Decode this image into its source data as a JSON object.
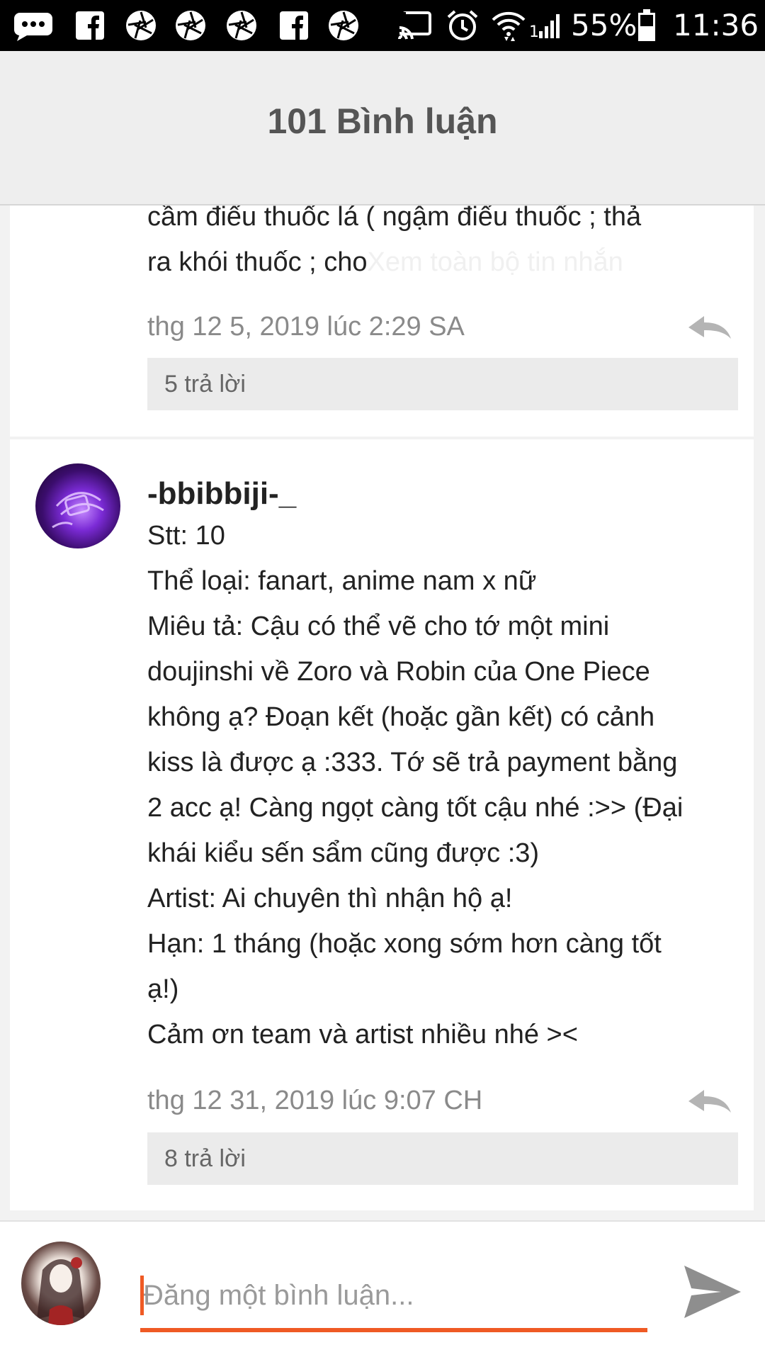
{
  "status_bar": {
    "battery": "55%",
    "time": "11:36",
    "icons": [
      "messenger-icon",
      "facebook-icon",
      "aperture-icon",
      "aperture-icon",
      "aperture-icon",
      "facebook-icon",
      "aperture-icon",
      "cast-icon",
      "alarm-icon",
      "wifi-icon",
      "signal-icon",
      "battery-icon"
    ]
  },
  "header": {
    "title": "101 Bình luận"
  },
  "comments": [
    {
      "lines": [
        "cầm điếu thuốc lá ( ngậm điếu thuốc  ; thả",
        "ra khói thuốc ; cho"
      ],
      "see_more": "Xem toàn bộ tin nhắn",
      "timestamp": "thg 12 5, 2019 lúc 2:29 SA",
      "replies": "5 trả lời"
    },
    {
      "username": "-bbibbiji-_",
      "lines": [
        "Stt: 10",
        "Thể loại: fanart, anime nam x nữ",
        "Miêu tả: Cậu có thể vẽ cho tớ một mini",
        "doujinshi về Zoro và Robin của One Piece",
        "không ạ? Đoạn kết (hoặc gần kết) có cảnh",
        "kiss là được ạ :333. Tớ sẽ trả payment bằng",
        "2 acc ạ! Càng ngọt càng tốt cậu nhé :>> (Đại",
        "khái kiểu sến sẩm cũng được :3)",
        "Artist: Ai chuyên thì nhận hộ ạ!",
        "Hạn: 1 tháng (hoặc xong sớm hơn càng tốt",
        "ạ!)",
        "Cảm ơn team và artist nhiều nhé ><"
      ],
      "timestamp": "thg 12 31, 2019 lúc 9:07 CH",
      "replies": "8 trả lời"
    }
  ],
  "composer": {
    "placeholder": "Đăng một bình luận...",
    "send_icon": "send-icon"
  },
  "colors": {
    "accent": "#ef5a24",
    "status_bar": "#000000",
    "header_bg": "#eeeeee"
  }
}
